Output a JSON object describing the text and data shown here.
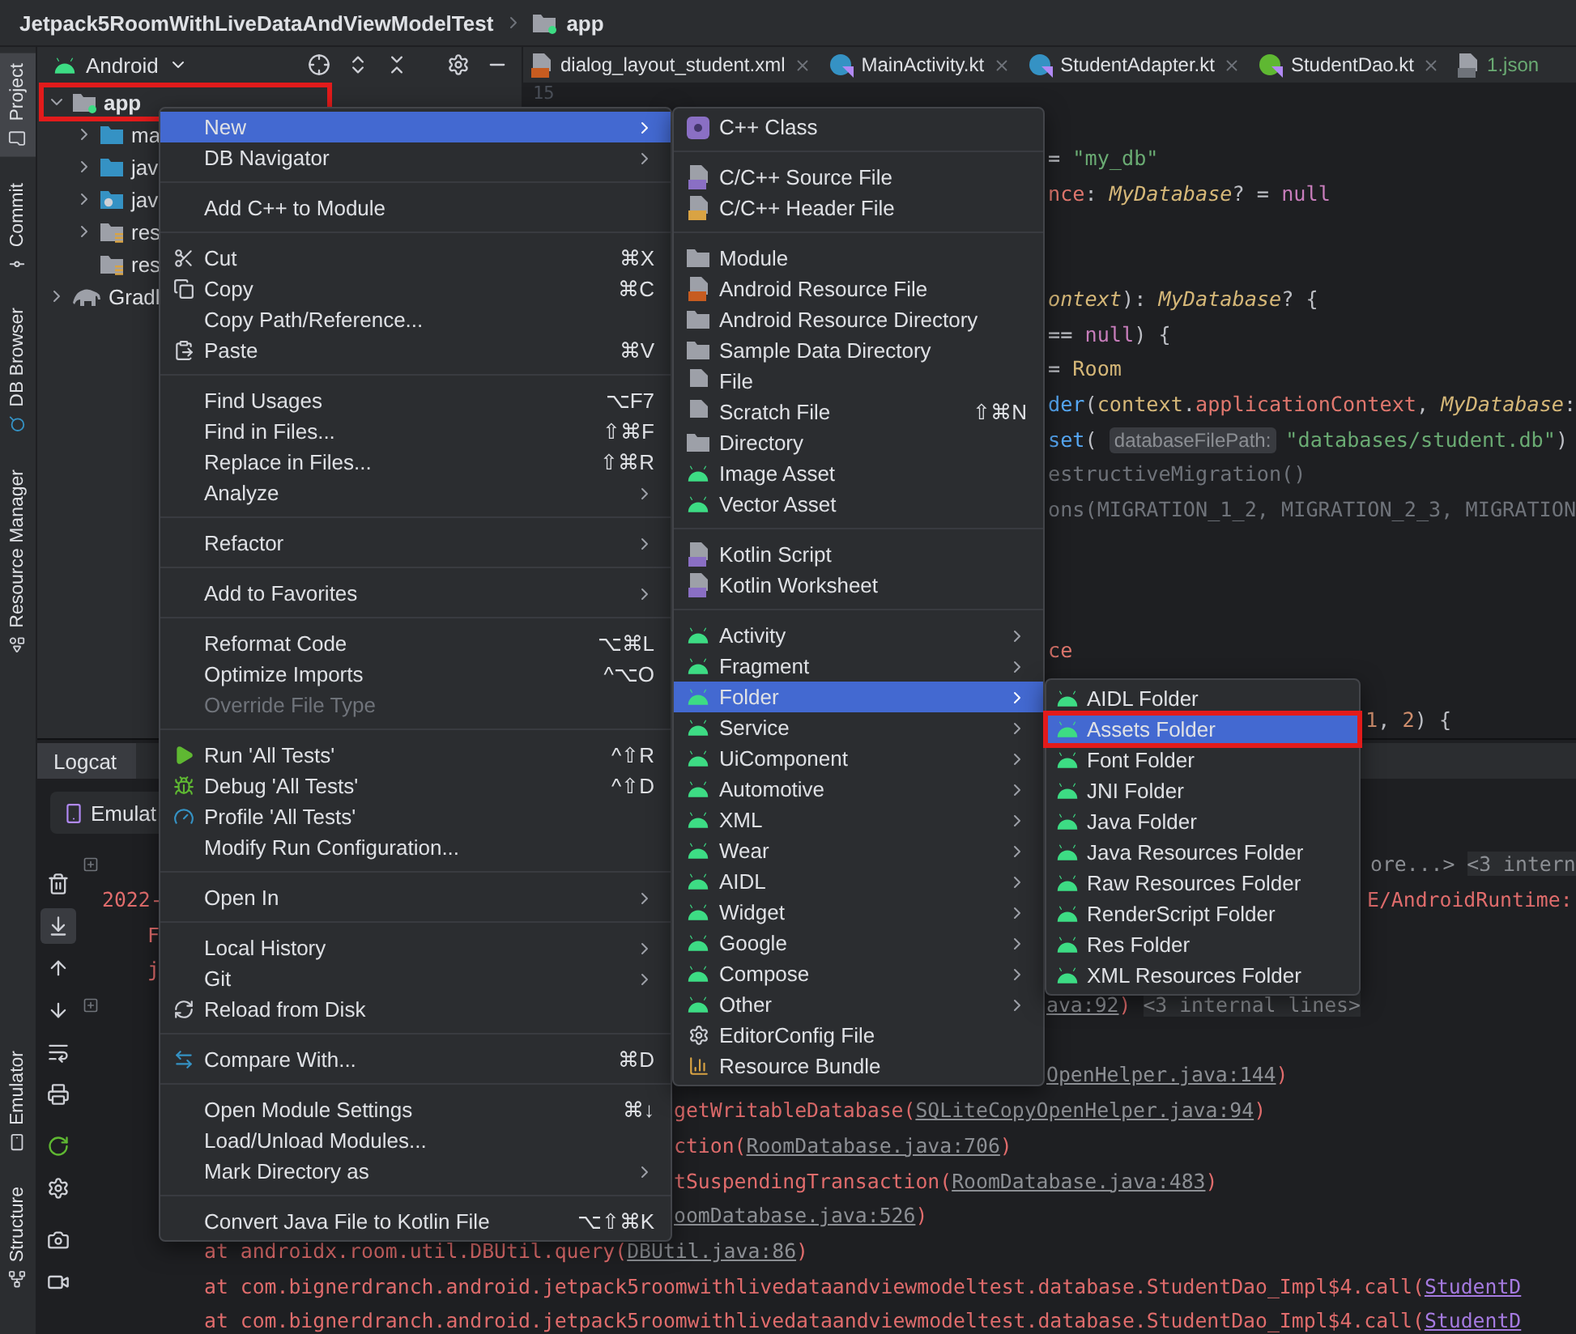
{
  "breadcrumb": {
    "project": "Jetpack5RoomWithLiveDataAndViewModelTest",
    "module": "app"
  },
  "tool_strip": {
    "top": [
      {
        "label": "Project",
        "selected": true
      },
      {
        "label": "Commit",
        "selected": false
      },
      {
        "label": "DB Browser",
        "selected": false
      },
      {
        "label": "Resource Manager",
        "selected": false
      }
    ],
    "bottom": [
      {
        "label": "Emulator",
        "selected": false
      },
      {
        "label": "Structure",
        "selected": false
      }
    ]
  },
  "project_panel": {
    "view": "Android",
    "tree": [
      {
        "label": "app",
        "kind": "module",
        "expandable": true,
        "expanded": true,
        "annotated": true,
        "children": [
          {
            "label": "ma",
            "kind": "source",
            "expandable": true,
            "expanded": false,
            "annotated": false
          },
          {
            "label": "jav",
            "kind": "source",
            "expandable": true,
            "expanded": false,
            "annotated": false
          },
          {
            "label": "jav",
            "kind": "generated",
            "expandable": true,
            "expanded": false,
            "annotated": false
          },
          {
            "label": "res",
            "kind": "resources",
            "expandable": true,
            "expanded": false,
            "annotated": false
          },
          {
            "label": "res",
            "kind": "resources",
            "expandable": false,
            "expanded": false,
            "annotated": false
          }
        ]
      },
      {
        "label": "Gradl",
        "kind": "gradle",
        "expandable": true,
        "expanded": false,
        "annotated": false
      }
    ]
  },
  "editor": {
    "tabs": [
      {
        "label": "dialog_layout_student.xml",
        "kind": "xml",
        "color": "#dfe1e5",
        "selected": false,
        "closable": true
      },
      {
        "label": "MainActivity.kt",
        "kind": "kotlin_class",
        "color": "#dfe1e5",
        "selected": false,
        "closable": true
      },
      {
        "label": "StudentAdapter.kt",
        "kind": "kotlin_class",
        "color": "#dfe1e5",
        "selected": false,
        "closable": true
      },
      {
        "label": "StudentDao.kt",
        "kind": "kotlin_interface",
        "color": "#dfe1e5",
        "selected": false,
        "closable": true
      },
      {
        "label": "1.json",
        "kind": "json",
        "color": "#6aab73",
        "selected": false,
        "closable": false
      }
    ],
    "line_number": "15",
    "code_lines": [
      {
        "segments": [
          {
            "kind": "plain",
            "text": "= "
          },
          {
            "kind": "string",
            "text": "\"my_db\""
          }
        ]
      },
      {
        "segments": [
          {
            "kind": "field",
            "text": "nce"
          },
          {
            "kind": "plain",
            "text": ": "
          },
          {
            "kind": "type",
            "text": "MyDatabase"
          },
          {
            "kind": "plain",
            "text": "? = "
          },
          {
            "kind": "keyword",
            "text": "null"
          }
        ]
      },
      {
        "segments": [
          {
            "kind": "type",
            "text": "ontext"
          },
          {
            "kind": "plain",
            "text": "): "
          },
          {
            "kind": "type",
            "text": "MyDatabase"
          },
          {
            "kind": "plain",
            "text": "? {"
          }
        ]
      },
      {
        "segments": [
          {
            "kind": "plain",
            "text": "== "
          },
          {
            "kind": "keyword",
            "text": "null"
          },
          {
            "kind": "plain",
            "text": ") {"
          }
        ]
      },
      {
        "segments": [
          {
            "kind": "plain",
            "text": "= "
          },
          {
            "kind": "class",
            "text": "Room"
          }
        ]
      },
      {
        "segments": [
          {
            "kind": "call",
            "text": "der"
          },
          {
            "kind": "plain",
            "text": "("
          },
          {
            "kind": "class",
            "text": "context"
          },
          {
            "kind": "plain",
            "text": "."
          },
          {
            "kind": "field",
            "text": "applicationContext"
          },
          {
            "kind": "plain",
            "text": ", "
          },
          {
            "kind": "type",
            "text": "MyDatabase"
          },
          {
            "kind": "plain",
            "text": ":"
          }
        ]
      },
      {
        "segments": [
          {
            "kind": "call",
            "text": "set"
          },
          {
            "kind": "plain",
            "text": "( "
          },
          {
            "kind": "hint",
            "text": "databaseFilePath:"
          },
          {
            "kind": "string",
            "text": "\"databases/student.db\""
          },
          {
            "kind": "plain",
            "text": ")"
          }
        ]
      },
      {
        "segments": [
          {
            "kind": "dim",
            "text": "estructiveMigration()"
          }
        ]
      },
      {
        "segments": [
          {
            "kind": "dim",
            "text": "ons(MIGRATION_1_2, MIGRATION_2_3, MIGRATION"
          }
        ]
      },
      {
        "segments": [
          {
            "kind": "field",
            "text": "ce"
          }
        ]
      },
      {
        "segments": [
          {
            "kind": "number",
            "text": "1"
          },
          {
            "kind": "plain",
            "text": ", "
          },
          {
            "kind": "number",
            "text": "2"
          },
          {
            "kind": "plain",
            "text": ") {"
          }
        ]
      }
    ]
  },
  "logcat": {
    "tab": "Logcat",
    "device": "Emulat",
    "toolbar": [
      {
        "selected": false
      },
      {
        "selected": true
      },
      {
        "selected": false
      },
      {
        "selected": false
      },
      {
        "selected": false
      },
      {
        "selected": false
      },
      {
        "selected": false
      },
      {
        "selected": false
      },
      {
        "selected": false
      },
      {
        "selected": false
      }
    ],
    "lines": [
      {
        "segments": [
          {
            "kind": "note",
            "text": "ore...>"
          },
          {
            "kind": "fold",
            "text": "<3 intern"
          }
        ]
      },
      {
        "segments": [
          {
            "kind": "error",
            "text": "2022-"
          }
        ]
      },
      {
        "segments": [
          {
            "kind": "error",
            "text": "E/AndroidRuntime:"
          }
        ]
      },
      {
        "segments": [
          {
            "kind": "error",
            "text": "F"
          }
        ]
      },
      {
        "segments": [
          {
            "kind": "error",
            "text": "j"
          }
        ]
      },
      {
        "segments": [
          {
            "kind": "link",
            "text": "ava:92"
          },
          {
            "kind": "error",
            "text": ")"
          },
          {
            "kind": "fold",
            "text": "<3 internal lines>"
          }
        ]
      },
      {
        "segments": [
          {
            "kind": "link",
            "text": "OpenHelper.java:144"
          },
          {
            "kind": "error",
            "text": ")"
          }
        ]
      },
      {
        "segments": [
          {
            "kind": "error",
            "text": "getWritableDatabase("
          },
          {
            "kind": "link",
            "text": "SQLiteCopyOpenHelper.java:94"
          },
          {
            "kind": "error",
            "text": ")"
          }
        ]
      },
      {
        "segments": [
          {
            "kind": "error",
            "text": "ction("
          },
          {
            "kind": "link",
            "text": "RoomDatabase.java:706"
          },
          {
            "kind": "error",
            "text": ")"
          }
        ]
      },
      {
        "segments": [
          {
            "kind": "error",
            "text": "tSuspendingTransaction("
          },
          {
            "kind": "link",
            "text": "RoomDatabase.java:483"
          },
          {
            "kind": "error",
            "text": ")"
          }
        ]
      },
      {
        "segments": [
          {
            "kind": "link",
            "text": "oomDatabase.java:526"
          },
          {
            "kind": "error",
            "text": ")"
          }
        ]
      },
      {
        "segments": [
          {
            "kind": "error",
            "text": "at androidx.room.util.DBUtil.query("
          },
          {
            "kind": "link",
            "text": "DBUtil.java:86"
          },
          {
            "kind": "error",
            "text": ")"
          }
        ]
      },
      {
        "segments": [
          {
            "kind": "error",
            "text": "at com.bignerdranch.android.jetpack5roomwithlivedataandviewmodeltest.database.StudentDao_Impl$4.call("
          },
          {
            "kind": "source",
            "text": "StudentD"
          }
        ]
      },
      {
        "segments": [
          {
            "kind": "error",
            "text": "at com.bignerdranch.android.jetpack5roomwithlivedataandviewmodeltest.database.StudentDao_Impl$4.call("
          },
          {
            "kind": "source",
            "text": "StudentD"
          }
        ]
      }
    ]
  },
  "context_menu": {
    "groups": [
      [
        {
          "label": "New",
          "submenu": true,
          "selected": true,
          "disabled": false
        },
        {
          "label": "DB Navigator",
          "submenu": true,
          "selected": false,
          "disabled": false
        }
      ],
      [
        {
          "label": "Add C++ to Module",
          "submenu": false,
          "selected": false,
          "disabled": false
        }
      ],
      [
        {
          "label": "Cut",
          "shortcut": "⌘X",
          "submenu": false,
          "selected": false,
          "disabled": false
        },
        {
          "label": "Copy",
          "shortcut": "⌘C",
          "submenu": false,
          "selected": false,
          "disabled": false
        },
        {
          "label": "Copy Path/Reference...",
          "submenu": false,
          "selected": false,
          "disabled": false
        },
        {
          "label": "Paste",
          "shortcut": "⌘V",
          "submenu": false,
          "selected": false,
          "disabled": false
        }
      ],
      [
        {
          "label": "Find Usages",
          "shortcut": "⌥F7",
          "submenu": false,
          "selected": false,
          "disabled": false
        },
        {
          "label": "Find in Files...",
          "shortcut": "⇧⌘F",
          "submenu": false,
          "selected": false,
          "disabled": false
        },
        {
          "label": "Replace in Files...",
          "shortcut": "⇧⌘R",
          "submenu": false,
          "selected": false,
          "disabled": false
        },
        {
          "label": "Analyze",
          "submenu": true,
          "selected": false,
          "disabled": false
        }
      ],
      [
        {
          "label": "Refactor",
          "submenu": true,
          "selected": false,
          "disabled": false
        }
      ],
      [
        {
          "label": "Add to Favorites",
          "submenu": true,
          "selected": false,
          "disabled": false
        }
      ],
      [
        {
          "label": "Reformat Code",
          "shortcut": "⌥⌘L",
          "submenu": false,
          "selected": false,
          "disabled": false
        },
        {
          "label": "Optimize Imports",
          "shortcut": "^⌥O",
          "submenu": false,
          "selected": false,
          "disabled": false
        },
        {
          "label": "Override File Type",
          "submenu": false,
          "selected": false,
          "disabled": true
        }
      ],
      [
        {
          "label": "Run 'All Tests'",
          "shortcut": "^⇧R",
          "submenu": false,
          "selected": false,
          "disabled": false
        },
        {
          "label": "Debug 'All Tests'",
          "shortcut": "^⇧D",
          "submenu": false,
          "selected": false,
          "disabled": false
        },
        {
          "label": "Profile 'All Tests'",
          "submenu": false,
          "selected": false,
          "disabled": false
        },
        {
          "label": "Modify Run Configuration...",
          "submenu": false,
          "selected": false,
          "disabled": false
        }
      ],
      [
        {
          "label": "Open In",
          "submenu": true,
          "selected": false,
          "disabled": false
        }
      ],
      [
        {
          "label": "Local History",
          "submenu": true,
          "selected": false,
          "disabled": false
        },
        {
          "label": "Git",
          "submenu": true,
          "selected": false,
          "disabled": false
        },
        {
          "label": "Reload from Disk",
          "submenu": false,
          "selected": false,
          "disabled": false
        }
      ],
      [
        {
          "label": "Compare With...",
          "shortcut": "⌘D",
          "submenu": false,
          "selected": false,
          "disabled": false
        }
      ],
      [
        {
          "label": "Open Module Settings",
          "shortcut": "⌘↓",
          "submenu": false,
          "selected": false,
          "disabled": false
        },
        {
          "label": "Load/Unload Modules...",
          "submenu": false,
          "selected": false,
          "disabled": false
        },
        {
          "label": "Mark Directory as",
          "submenu": true,
          "selected": false,
          "disabled": false
        }
      ],
      [
        {
          "label": "Convert Java File to Kotlin File",
          "shortcut": "⌥⇧⌘K",
          "submenu": false,
          "selected": false,
          "disabled": false
        }
      ]
    ]
  },
  "new_submenu": {
    "groups": [
      [
        {
          "label": "C++ Class",
          "submenu": false,
          "selected": false
        }
      ],
      [
        {
          "label": "C/C++ Source File",
          "submenu": false,
          "selected": false
        },
        {
          "label": "C/C++ Header File",
          "submenu": false,
          "selected": false
        }
      ],
      [
        {
          "label": "Module",
          "submenu": false,
          "selected": false
        },
        {
          "label": "Android Resource File",
          "submenu": false,
          "selected": false
        },
        {
          "label": "Android Resource Directory",
          "submenu": false,
          "selected": false
        },
        {
          "label": "Sample Data Directory",
          "submenu": false,
          "selected": false
        },
        {
          "label": "File",
          "submenu": false,
          "selected": false
        },
        {
          "label": "Scratch File",
          "shortcut": "⇧⌘N",
          "submenu": false,
          "selected": false
        },
        {
          "label": "Directory",
          "submenu": false,
          "selected": false
        },
        {
          "label": "Image Asset",
          "submenu": false,
          "selected": false
        },
        {
          "label": "Vector Asset",
          "submenu": false,
          "selected": false
        }
      ],
      [
        {
          "label": "Kotlin Script",
          "submenu": false,
          "selected": false
        },
        {
          "label": "Kotlin Worksheet",
          "submenu": false,
          "selected": false
        }
      ],
      [
        {
          "label": "Activity",
          "submenu": true,
          "selected": false
        },
        {
          "label": "Fragment",
          "submenu": true,
          "selected": false
        },
        {
          "label": "Folder",
          "submenu": true,
          "selected": true
        },
        {
          "label": "Service",
          "submenu": true,
          "selected": false
        },
        {
          "label": "UiComponent",
          "submenu": true,
          "selected": false
        },
        {
          "label": "Automotive",
          "submenu": true,
          "selected": false
        },
        {
          "label": "XML",
          "submenu": true,
          "selected": false
        },
        {
          "label": "Wear",
          "submenu": true,
          "selected": false
        },
        {
          "label": "AIDL",
          "submenu": true,
          "selected": false
        },
        {
          "label": "Widget",
          "submenu": true,
          "selected": false
        },
        {
          "label": "Google",
          "submenu": true,
          "selected": false
        },
        {
          "label": "Compose",
          "submenu": true,
          "selected": false
        },
        {
          "label": "Other",
          "submenu": true,
          "selected": false
        },
        {
          "label": "EditorConfig File",
          "submenu": false,
          "selected": false
        },
        {
          "label": "Resource Bundle",
          "submenu": false,
          "selected": false
        }
      ]
    ]
  },
  "folder_submenu": {
    "items": [
      {
        "label": "AIDL Folder",
        "selected": false,
        "annotated": false
      },
      {
        "label": "Assets Folder",
        "selected": true,
        "annotated": true
      },
      {
        "label": "Font Folder",
        "selected": false,
        "annotated": false
      },
      {
        "label": "JNI Folder",
        "selected": false,
        "annotated": false
      },
      {
        "label": "Java Folder",
        "selected": false,
        "annotated": false
      },
      {
        "label": "Java Resources Folder",
        "selected": false,
        "annotated": false
      },
      {
        "label": "Raw Resources Folder",
        "selected": false,
        "annotated": false
      },
      {
        "label": "RenderScript Folder",
        "selected": false,
        "annotated": false
      },
      {
        "label": "Res Folder",
        "selected": false,
        "annotated": false
      },
      {
        "label": "XML Resources Folder",
        "selected": false,
        "annotated": false
      }
    ]
  }
}
